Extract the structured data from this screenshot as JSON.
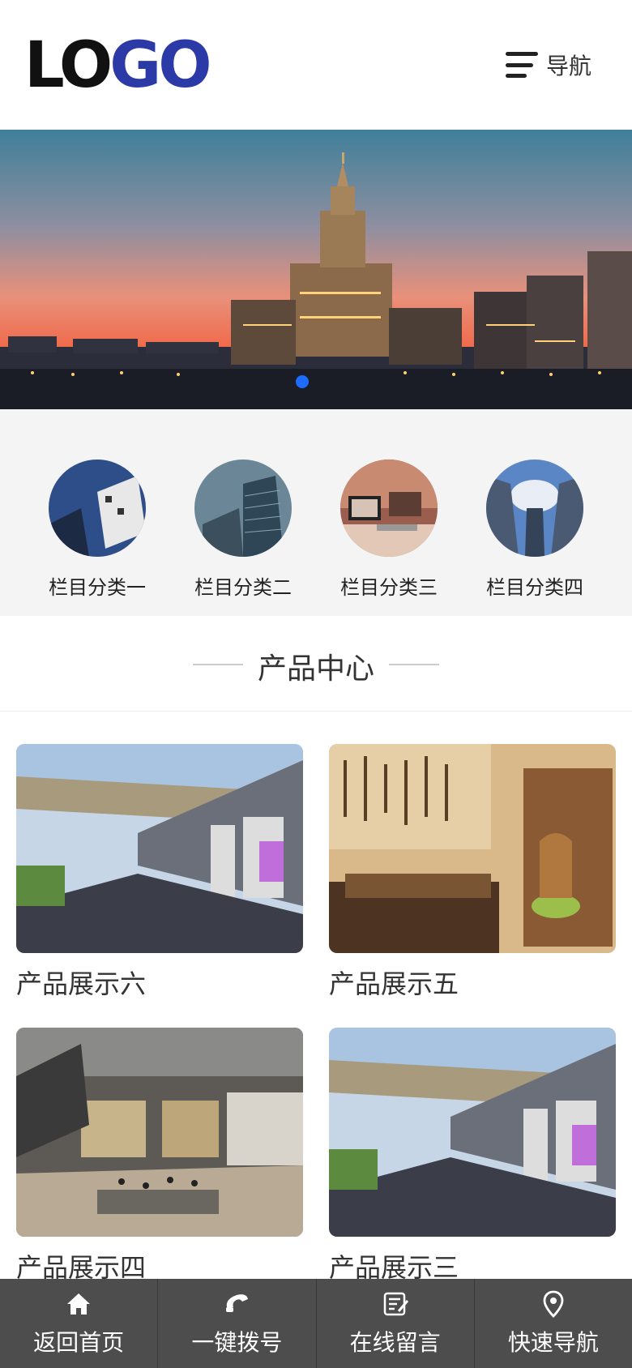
{
  "header": {
    "logo_part1": "LO",
    "logo_part2": "GO",
    "nav_label": "导航"
  },
  "categories": [
    {
      "label": "栏目分类一",
      "icon": "building-photo"
    },
    {
      "label": "栏目分类二",
      "icon": "skyscraper-photo"
    },
    {
      "label": "栏目分类三",
      "icon": "desk-photo"
    },
    {
      "label": "栏目分类四",
      "icon": "towers-sky-photo"
    }
  ],
  "section": {
    "title": "产品中心"
  },
  "products": [
    {
      "name": "产品展示六"
    },
    {
      "name": "产品展示五"
    },
    {
      "name": "产品展示四"
    },
    {
      "name": "产品展示三"
    }
  ],
  "footer": {
    "items": [
      {
        "label": "返回首页",
        "icon": "home-icon"
      },
      {
        "label": "一键拨号",
        "icon": "phone-icon"
      },
      {
        "label": "在线留言",
        "icon": "message-icon"
      },
      {
        "label": "快速导航",
        "icon": "location-pin-icon"
      }
    ]
  },
  "colors": {
    "logo_accent": "#2b3aa6",
    "footer_bg": "#4d4d4d",
    "active_dot": "#1e6bff"
  }
}
